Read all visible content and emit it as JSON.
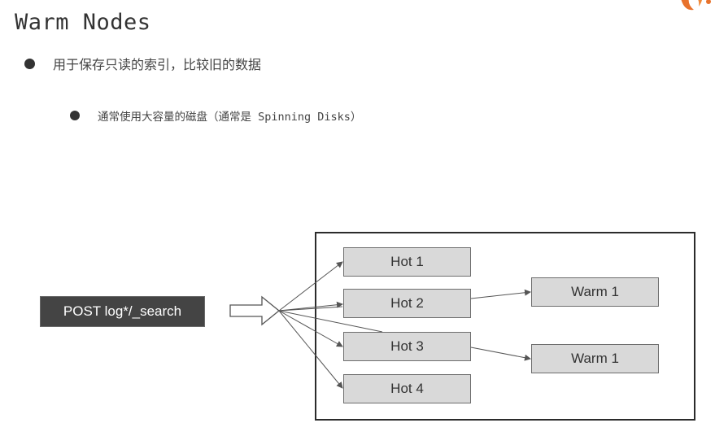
{
  "slide": {
    "title": "Warm Nodes",
    "bullets": [
      "用于保存只读的索引，比较旧的数据",
      "通常使用大容量的磁盘（通常是 Spinning Disks）"
    ]
  },
  "diagram": {
    "request_label": "POST log*/_search",
    "hot_nodes": [
      "Hot 1",
      "Hot 2",
      "Hot 3",
      "Hot 4"
    ],
    "warm_nodes": [
      "Warm 1",
      "Warm 1"
    ]
  },
  "colors": {
    "request_bg": "#444444",
    "node_bg": "#d9d9d9",
    "logo_orange": "#e8722c"
  },
  "icons": {
    "logo": "orange-logo-icon",
    "bullet": "filled-circle-bullet",
    "request_arrow": "block-right-arrow"
  }
}
